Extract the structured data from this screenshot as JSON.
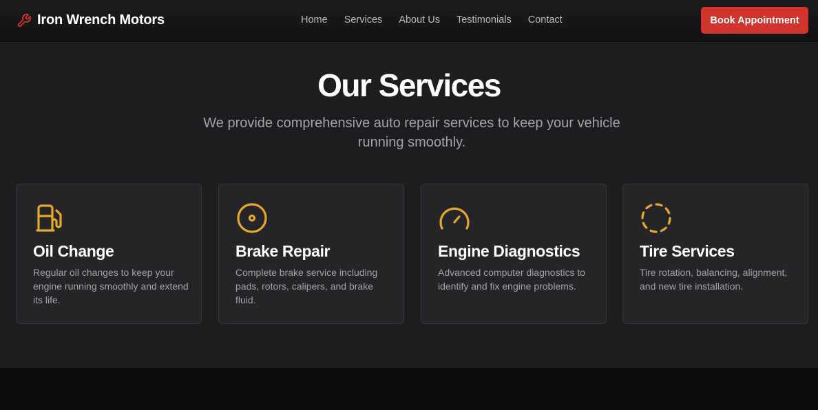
{
  "colors": {
    "accent": "#d0342c",
    "icon": "#e5a92c",
    "background": "#1d1d1f",
    "card": "#252527"
  },
  "brand": {
    "name": "Iron Wrench Motors",
    "icon": "wrench-icon"
  },
  "nav": {
    "links": [
      {
        "label": "Home"
      },
      {
        "label": "Services"
      },
      {
        "label": "About Us"
      },
      {
        "label": "Testimonials"
      },
      {
        "label": "Contact"
      }
    ],
    "cta_label": "Book Appointment"
  },
  "services": {
    "title": "Our Services",
    "subtitle": "We provide comprehensive auto repair services to keep your vehicle running smoothly.",
    "cards": [
      {
        "icon": "fuel-pump-icon",
        "title": "Oil Change",
        "description": "Regular oil changes to keep your engine running smoothly and extend its life."
      },
      {
        "icon": "disc-icon",
        "title": "Brake Repair",
        "description": "Complete brake service including pads, rotors, calipers, and brake fluid."
      },
      {
        "icon": "gauge-icon",
        "title": "Engine Diagnostics",
        "description": "Advanced computer diagnostics to identify and fix engine problems."
      },
      {
        "icon": "dashed-circle-icon",
        "title": "Tire Services",
        "description": "Tire rotation, balancing, alignment, and new tire installation."
      }
    ]
  }
}
